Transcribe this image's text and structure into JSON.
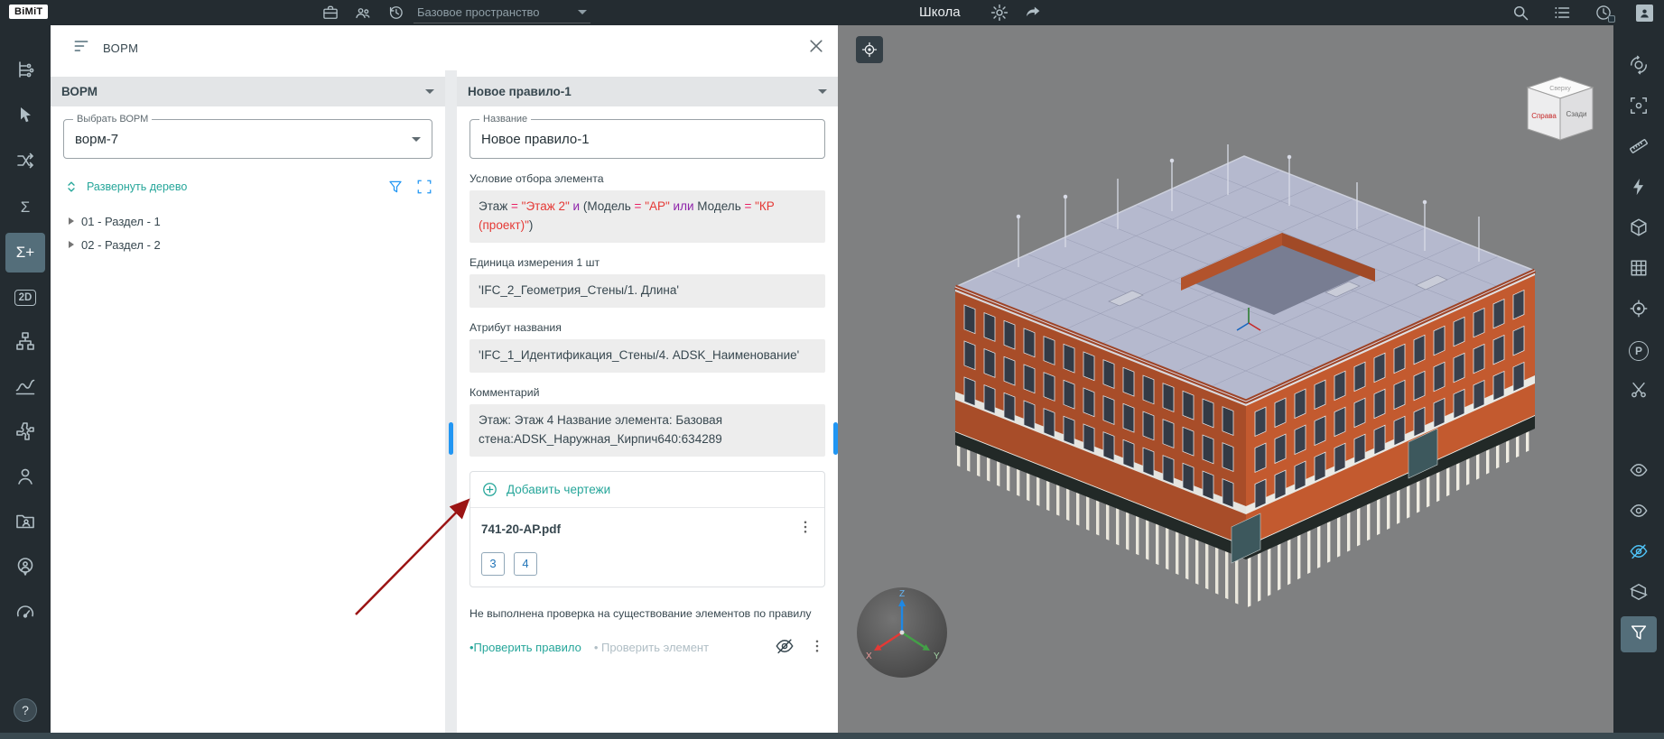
{
  "topbar": {
    "logo": "BiMiT",
    "workspace_value": "Базовое пространство",
    "title": "Школа",
    "icons_left": [
      "projects",
      "team",
      "history"
    ],
    "icons_right": [
      "search",
      "list-menu",
      "recent",
      "account"
    ]
  },
  "left_rail": {
    "items": [
      {
        "name": "model-tree"
      },
      {
        "name": "select"
      },
      {
        "name": "connections"
      },
      {
        "name": "sum",
        "glyph": "Σ"
      },
      {
        "name": "sum-plus",
        "glyph": "Σ+",
        "active": true
      },
      {
        "name": "view-2d",
        "glyph": "2D",
        "boxed": true
      },
      {
        "name": "structure"
      },
      {
        "name": "graphs"
      },
      {
        "name": "plugins"
      },
      {
        "name": "users"
      },
      {
        "name": "shared-folder"
      },
      {
        "name": "user-pin"
      },
      {
        "name": "dashboard"
      }
    ],
    "help_glyph": "?"
  },
  "right_rail": {
    "items": [
      {
        "name": "orbit"
      },
      {
        "name": "frame"
      },
      {
        "name": "measure"
      },
      {
        "name": "quick-measure"
      },
      {
        "name": "model"
      },
      {
        "name": "grid"
      },
      {
        "name": "focus"
      },
      {
        "name": "plan",
        "glyph": "P",
        "circled": true
      },
      {
        "name": "section-cut"
      },
      {
        "name": "visibility-1",
        "gap": true
      },
      {
        "name": "visibility-2"
      },
      {
        "name": "visibility-off",
        "accent": true
      },
      {
        "name": "clip-box"
      },
      {
        "name": "filter",
        "active": true
      }
    ]
  },
  "panel_header": {
    "title": "ВОРМ"
  },
  "vorm_panel": {
    "section_title": "ВОРМ",
    "select_label": "Выбрать ВОРМ",
    "select_value": "ворм-7",
    "expand_label": "Развернуть дерево",
    "tree": [
      {
        "label": "01 - Раздел - 1"
      },
      {
        "label": "02 - Раздел - 2"
      }
    ]
  },
  "rule_panel": {
    "section_title": "Новое правило-1",
    "name_label": "Название",
    "name_value": "Новое правило-1",
    "condition_label": "Условие отбора элемента",
    "condition": {
      "tokens": [
        {
          "text": "Этаж ",
          "type": "field"
        },
        {
          "text": "= ",
          "type": "op"
        },
        {
          "text": "\"Этаж 2\" ",
          "type": "string"
        },
        {
          "text": "и ",
          "type": "logic"
        },
        {
          "text": "(Модель ",
          "type": "field"
        },
        {
          "text": "= ",
          "type": "op"
        },
        {
          "text": "\"АР\" ",
          "type": "string"
        },
        {
          "text": "или ",
          "type": "logic"
        },
        {
          "text": "Модель ",
          "type": "field"
        },
        {
          "text": "= ",
          "type": "op"
        },
        {
          "text": "\"КР (проект)\"",
          "type": "string"
        },
        {
          "text": ")",
          "type": "field"
        }
      ]
    },
    "unit_label": "Единица измерения 1 шт",
    "unit_value": "'IFC_2_Геометрия_Стены/1. Длина'",
    "attr_label": "Атрибут названия",
    "attr_value": "'IFC_1_Идентификация_Стены/4. ADSK_Наименование'",
    "comment_label": "Комментарий",
    "comment_value": "Этаж: Этаж 4 Название элемента: Базовая стена:ADSK_Наружная_Кирпич640:634289",
    "add_drawings_label": "Добавить чертежи",
    "file_name": "741-20-АР.pdf",
    "chips": [
      "3",
      "4"
    ],
    "warning": "Не выполнена проверка на существование элементов по правилу",
    "check_rule_label": "•Проверить правило",
    "check_element_label": "• Проверить элемент"
  },
  "viewport": {
    "cube": {
      "top": "Сверху",
      "left": "Справа",
      "right": "Сзади"
    },
    "axes": {
      "x": "X",
      "y": "Y",
      "z": "Z"
    }
  },
  "colors": {
    "topbar_bg": "#242c31",
    "accent_teal": "#26a69a",
    "accent_blue": "#2196f3",
    "condition_op": "#e91e63",
    "condition_string": "#e53935",
    "condition_logic": "#8e24aa",
    "annotation_arrow": "#9b1414",
    "building_brick": "#c35a2f",
    "building_roof": "#b5b9ce"
  }
}
